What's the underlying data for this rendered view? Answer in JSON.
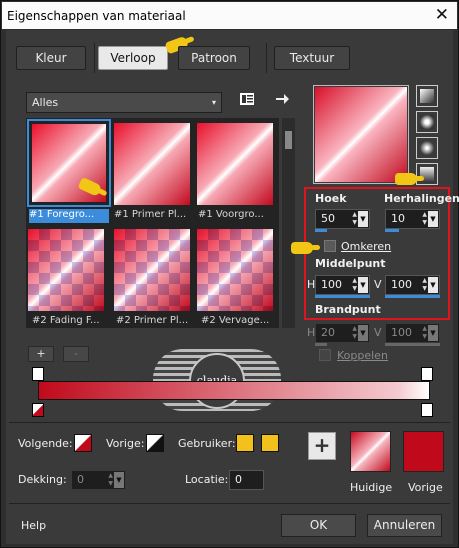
{
  "window": {
    "title": "Eigenschappen van materiaal",
    "close_glyph": "✕"
  },
  "tabs": [
    "Kleur",
    "Verloop",
    "Patroon",
    "Textuur"
  ],
  "active_tab": "Verloop",
  "category": {
    "value": "Alles",
    "arrow": "▾"
  },
  "grid_items": [
    {
      "label": "#1 Foregro...",
      "selected": true,
      "style": "solid"
    },
    {
      "label": "#1 Primer Pl...",
      "selected": false,
      "style": "solid"
    },
    {
      "label": "#1 Voorgro...",
      "selected": false,
      "style": "solid"
    },
    {
      "label": "#2 Fading F...",
      "selected": false,
      "style": "checker"
    },
    {
      "label": "#2 Primer Pl...",
      "selected": false,
      "style": "checker"
    },
    {
      "label": "#2 Vervage...",
      "selected": false,
      "style": "checker"
    }
  ],
  "gradient": {
    "hoek_label": "Hoek",
    "hoek_value": "50",
    "herhalingen_label": "Herhalingen",
    "herhalingen_value": "10",
    "omkeren_label": "Omkeren",
    "middelpunt_label": "Middelpunt",
    "h_label": "H",
    "h_value": "100",
    "v_label": "V",
    "v_value": "100",
    "brandpunt_label": "Brandpunt",
    "bh_value": "20",
    "bv_value": "100",
    "koppelen_label": "Koppelen"
  },
  "editor": {
    "add_label": "+",
    "remove_label": "-",
    "volgende_label": "Volgende:",
    "vorige_label": "Vorige:",
    "gebruiker_label": "Gebruiker:",
    "dekking_label": "Dekking:",
    "dekking_value": "0",
    "locatie_label": "Locatie:",
    "locatie_value": "0",
    "add_swatch_label": "+"
  },
  "swatches": {
    "huidige_label": "Huidige",
    "vorige_label": "Vorige"
  },
  "colors": {
    "accent_red": "#c00a1c",
    "user_yellow": "#f3c11b",
    "select_blue": "#3c8cdc"
  },
  "watermark": {
    "text": "claudia"
  },
  "footer": {
    "help_label": "Help",
    "ok_label": "OK",
    "cancel_label": "Annuleren"
  }
}
